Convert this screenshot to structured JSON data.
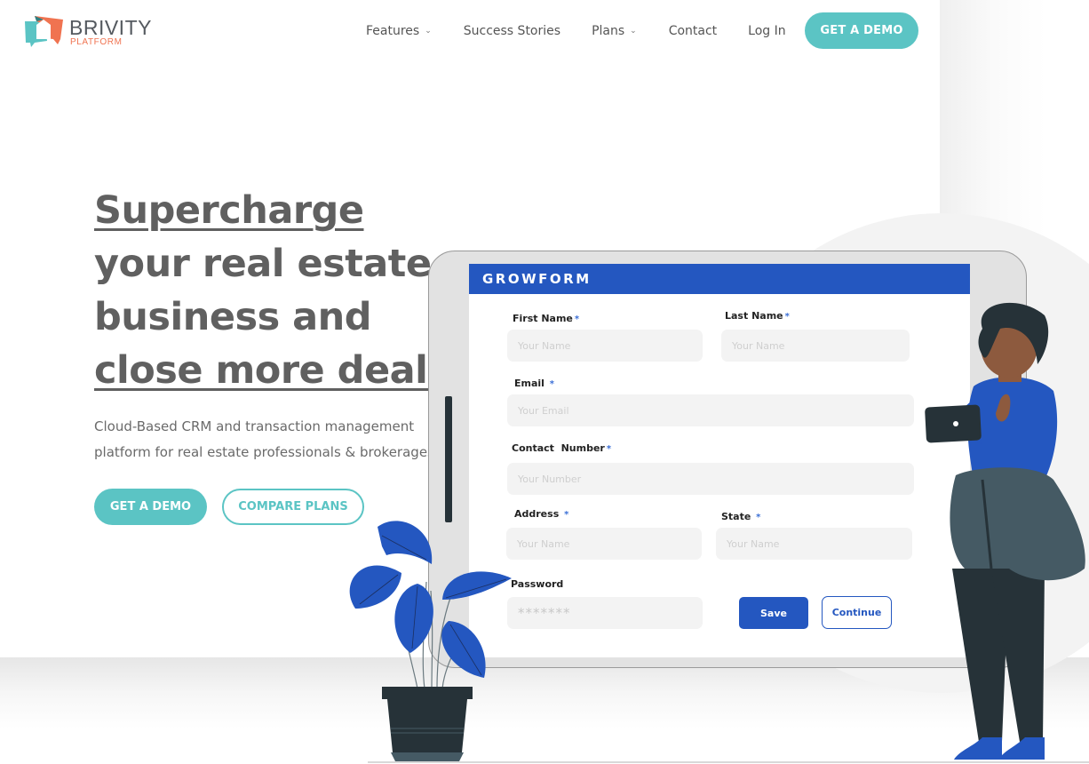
{
  "brand": {
    "name": "BRIVITY",
    "sub": "PLATFORM",
    "colors": {
      "teal": "#5bc4c4",
      "orange": "#f07350",
      "blue": "#2457c0",
      "dark": "#263238"
    }
  },
  "nav": {
    "items": [
      {
        "label": "Features",
        "has_dropdown": true,
        "icon": "chevron-down-icon"
      },
      {
        "label": "Success Stories",
        "has_dropdown": false
      },
      {
        "label": "Plans",
        "has_dropdown": true,
        "icon": "chevron-down-icon"
      },
      {
        "label": "Contact",
        "has_dropdown": false
      },
      {
        "label": "Log In",
        "has_dropdown": false
      }
    ],
    "cta_label": "GET A DEMO"
  },
  "hero": {
    "headline_part1": "Supercharge",
    "headline_part2": " your real estate business and ",
    "headline_part3": "close more deals",
    "subtext_line1": "Cloud-Based CRM and transaction management",
    "subtext_line2": "platform for real estate professionals & brokerages",
    "primary_cta": "GET A DEMO",
    "secondary_cta": "COMPARE PLANS"
  },
  "illustration_form": {
    "title": "GROWFORM",
    "required_mark": "*",
    "fields": {
      "first_name": {
        "label": "First Name",
        "placeholder": "Your Name",
        "required": true
      },
      "last_name": {
        "label": "Last Name",
        "placeholder": "Your Name",
        "required": true
      },
      "email": {
        "label": "Email",
        "placeholder": "Your Email",
        "required": true
      },
      "contact_number": {
        "label": "Contact  Number",
        "placeholder": "Your Number",
        "required": true
      },
      "address": {
        "label": "Address",
        "placeholder": "Your Name",
        "required": true
      },
      "state": {
        "label": "State",
        "placeholder": "Your Name",
        "required": true
      },
      "password": {
        "label": "Password",
        "placeholder": "*******",
        "required": false
      }
    },
    "save_label": "Save",
    "continue_label": "Continue"
  }
}
